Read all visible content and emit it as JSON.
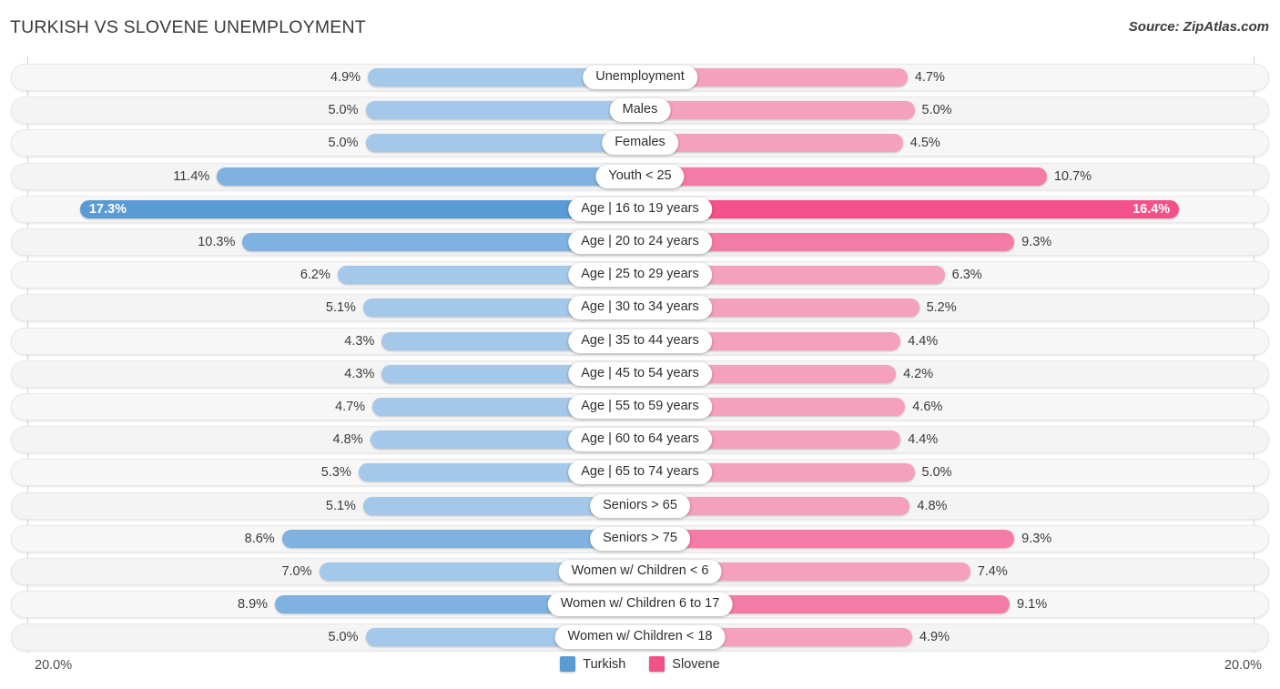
{
  "header": {
    "title": "TURKISH VS SLOVENE UNEMPLOYMENT",
    "source": "Source: ZipAtlas.com"
  },
  "axis": {
    "left_label": "20.0%",
    "right_label": "20.0%",
    "max": 20.0
  },
  "legend": {
    "items": [
      {
        "label": "Turkish",
        "color": "#5b9bd5"
      },
      {
        "label": "Slovene",
        "color": "#f2518a"
      }
    ]
  },
  "colors": {
    "turkish_light": "#a4c8ea",
    "turkish_mid": "#7fb2e0",
    "turkish_dark": "#5b9bd5",
    "slovene_light": "#f5a0bd",
    "slovene_mid": "#f57ba7",
    "slovene_dark": "#f2518a"
  },
  "chart_data": {
    "type": "bar",
    "title": "TURKISH VS SLOVENE UNEMPLOYMENT",
    "subtitle": "Source: ZipAtlas.com",
    "orientation": "horizontal-diverging",
    "xlabel": "",
    "ylabel": "",
    "xlim": [
      20.0,
      20.0
    ],
    "grid": false,
    "legend_position": "bottom-center",
    "categories": [
      "Unemployment",
      "Males",
      "Females",
      "Youth < 25",
      "Age | 16 to 19 years",
      "Age | 20 to 24 years",
      "Age | 25 to 29 years",
      "Age | 30 to 34 years",
      "Age | 35 to 44 years",
      "Age | 45 to 54 years",
      "Age | 55 to 59 years",
      "Age | 60 to 64 years",
      "Age | 65 to 74 years",
      "Seniors > 65",
      "Seniors > 75",
      "Women w/ Children < 6",
      "Women w/ Children 6 to 17",
      "Women w/ Children < 18"
    ],
    "series": [
      {
        "name": "Turkish",
        "color": "#5b9bd5",
        "values": [
          4.9,
          5.0,
          5.0,
          11.4,
          17.3,
          10.3,
          6.2,
          5.1,
          4.3,
          4.3,
          4.7,
          4.8,
          5.3,
          5.1,
          8.6,
          7.0,
          8.9,
          5.0
        ],
        "labels": [
          "4.9%",
          "5.0%",
          "5.0%",
          "11.4%",
          "17.3%",
          "10.3%",
          "6.2%",
          "5.1%",
          "4.3%",
          "4.3%",
          "4.7%",
          "4.8%",
          "5.3%",
          "5.1%",
          "8.6%",
          "7.0%",
          "8.9%",
          "5.0%"
        ]
      },
      {
        "name": "Slovene",
        "color": "#f2518a",
        "values": [
          4.7,
          5.0,
          4.5,
          10.7,
          16.4,
          9.3,
          6.3,
          5.2,
          4.4,
          4.2,
          4.6,
          4.4,
          5.0,
          4.8,
          9.3,
          7.4,
          9.1,
          4.9
        ],
        "labels": [
          "4.7%",
          "5.0%",
          "4.5%",
          "10.7%",
          "16.4%",
          "9.3%",
          "6.3%",
          "5.2%",
          "4.4%",
          "4.2%",
          "4.6%",
          "4.4%",
          "5.0%",
          "4.8%",
          "9.3%",
          "7.4%",
          "9.1%",
          "4.9%"
        ]
      }
    ],
    "rows": [
      {
        "label": "Unemployment",
        "left_value": 4.9,
        "left_label": "4.9%",
        "right_value": 4.7,
        "right_label": "4.7%",
        "emphasis": "light"
      },
      {
        "label": "Males",
        "left_value": 5.0,
        "left_label": "5.0%",
        "right_value": 5.0,
        "right_label": "5.0%",
        "emphasis": "light"
      },
      {
        "label": "Females",
        "left_value": 5.0,
        "left_label": "5.0%",
        "right_value": 4.5,
        "right_label": "4.5%",
        "emphasis": "light"
      },
      {
        "label": "Youth < 25",
        "left_value": 11.4,
        "left_label": "11.4%",
        "right_value": 10.7,
        "right_label": "10.7%",
        "emphasis": "mid"
      },
      {
        "label": "Age | 16 to 19 years",
        "left_value": 17.3,
        "left_label": "17.3%",
        "right_value": 16.4,
        "right_label": "16.4%",
        "emphasis": "high"
      },
      {
        "label": "Age | 20 to 24 years",
        "left_value": 10.3,
        "left_label": "10.3%",
        "right_value": 9.3,
        "right_label": "9.3%",
        "emphasis": "mid"
      },
      {
        "label": "Age | 25 to 29 years",
        "left_value": 6.2,
        "left_label": "6.2%",
        "right_value": 6.3,
        "right_label": "6.3%",
        "emphasis": "light"
      },
      {
        "label": "Age | 30 to 34 years",
        "left_value": 5.1,
        "left_label": "5.1%",
        "right_value": 5.2,
        "right_label": "5.2%",
        "emphasis": "light"
      },
      {
        "label": "Age | 35 to 44 years",
        "left_value": 4.3,
        "left_label": "4.3%",
        "right_value": 4.4,
        "right_label": "4.4%",
        "emphasis": "light"
      },
      {
        "label": "Age | 45 to 54 years",
        "left_value": 4.3,
        "left_label": "4.3%",
        "right_value": 4.2,
        "right_label": "4.2%",
        "emphasis": "light"
      },
      {
        "label": "Age | 55 to 59 years",
        "left_value": 4.7,
        "left_label": "4.7%",
        "right_value": 4.6,
        "right_label": "4.6%",
        "emphasis": "light"
      },
      {
        "label": "Age | 60 to 64 years",
        "left_value": 4.8,
        "left_label": "4.8%",
        "right_value": 4.4,
        "right_label": "4.4%",
        "emphasis": "light"
      },
      {
        "label": "Age | 65 to 74 years",
        "left_value": 5.3,
        "left_label": "5.3%",
        "right_value": 5.0,
        "right_label": "5.0%",
        "emphasis": "light"
      },
      {
        "label": "Seniors > 65",
        "left_value": 5.1,
        "left_label": "5.1%",
        "right_value": 4.8,
        "right_label": "4.8%",
        "emphasis": "light"
      },
      {
        "label": "Seniors > 75",
        "left_value": 8.6,
        "left_label": "8.6%",
        "right_value": 9.3,
        "right_label": "9.3%",
        "emphasis": "mid"
      },
      {
        "label": "Women w/ Children < 6",
        "left_value": 7.0,
        "left_label": "7.0%",
        "right_value": 7.4,
        "right_label": "7.4%",
        "emphasis": "light"
      },
      {
        "label": "Women w/ Children 6 to 17",
        "left_value": 8.9,
        "left_label": "8.9%",
        "right_value": 9.1,
        "right_label": "9.1%",
        "emphasis": "mid"
      },
      {
        "label": "Women w/ Children < 18",
        "left_value": 5.0,
        "left_label": "5.0%",
        "right_value": 4.9,
        "right_label": "4.9%",
        "emphasis": "light"
      }
    ]
  }
}
